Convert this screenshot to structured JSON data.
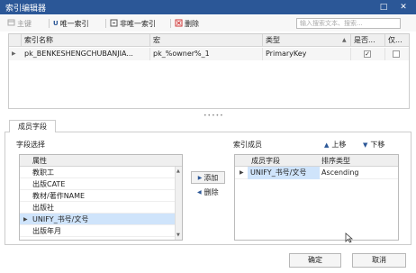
{
  "window": {
    "title": "索引编辑器",
    "controls": [
      "□",
      "✕"
    ]
  },
  "toolbar": {
    "primary_key": "主键",
    "unique_index": "唯一索引",
    "non_unique_index": "非唯一索引",
    "delete": "删除",
    "search_placeholder": "输入搜索文本、搜索..."
  },
  "index_table": {
    "columns": [
      "索引名称",
      "宏",
      "类型",
      "是否...",
      "仅..."
    ],
    "rows": [
      {
        "name": "pk_BENKESHENGCHUBANJIA...",
        "macro": "pk_%owner%_1",
        "type": "PrimaryKey",
        "col4_checked": true,
        "col5_checked": false
      }
    ]
  },
  "tab": {
    "label": "成员字段"
  },
  "field_select": {
    "label": "字段选择",
    "header": "属性",
    "items": [
      "教职工",
      "出版CATE",
      "教材/著作NAME",
      "出版社",
      "UNIFY_书号/文号",
      "出版年月"
    ],
    "selected_index": 4
  },
  "middle": {
    "add": "添加",
    "remove": "删除"
  },
  "members": {
    "label": "索引成员",
    "move_up": "上移",
    "move_down": "下移",
    "columns": [
      "成员字段",
      "排序类型"
    ],
    "rows": [
      {
        "field": "UNIFY_书号/文号",
        "sort": "Ascending"
      }
    ]
  },
  "footer": {
    "ok": "确定",
    "cancel": "取消"
  },
  "colors": {
    "titlebar": "#2b5797",
    "selection": "#cfe4fb"
  }
}
